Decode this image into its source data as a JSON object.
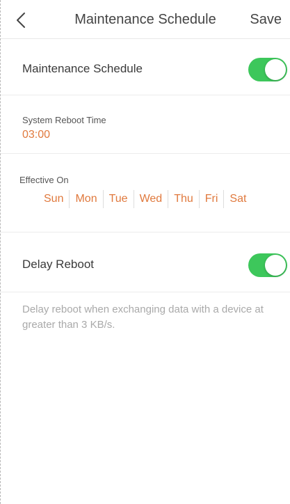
{
  "header": {
    "title": "Maintenance Schedule",
    "save_label": "Save"
  },
  "maintenance": {
    "label": "Maintenance Schedule",
    "enabled": true
  },
  "reboot_time": {
    "label": "System Reboot Time",
    "value": "03:00"
  },
  "effective_on": {
    "label": "Effective On",
    "days": [
      "Sun",
      "Mon",
      "Tue",
      "Wed",
      "Thu",
      "Fri",
      "Sat"
    ]
  },
  "delay_reboot": {
    "label": "Delay Reboot",
    "enabled": true,
    "note": "Delay reboot when exchanging data with a device at greater than 3 KB/s."
  },
  "colors": {
    "accent": "#e0793d",
    "toggle_on": "#3dc75b"
  }
}
